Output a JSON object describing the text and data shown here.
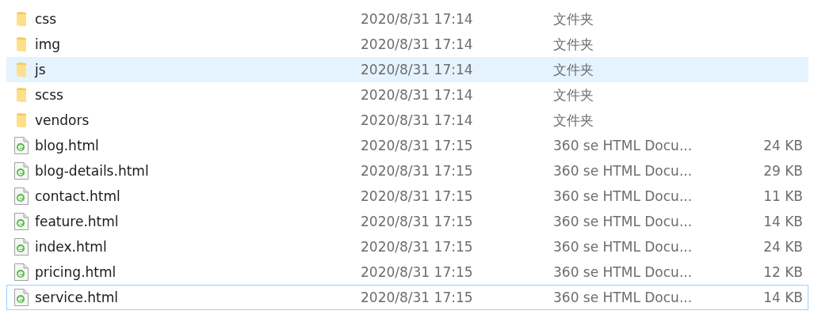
{
  "files": [
    {
      "kind": "folder",
      "name": "css",
      "modified": "2020/8/31 17:14",
      "type": "文件夹",
      "highlighted": false,
      "focused": false
    },
    {
      "kind": "folder",
      "name": "img",
      "modified": "2020/8/31 17:14",
      "type": "文件夹",
      "highlighted": false,
      "focused": false
    },
    {
      "kind": "folder",
      "name": "js",
      "modified": "2020/8/31 17:14",
      "type": "文件夹",
      "highlighted": true,
      "focused": false
    },
    {
      "kind": "folder",
      "name": "scss",
      "modified": "2020/8/31 17:14",
      "type": "文件夹",
      "highlighted": false,
      "focused": false
    },
    {
      "kind": "folder",
      "name": "vendors",
      "modified": "2020/8/31 17:14",
      "type": "文件夹",
      "highlighted": false,
      "focused": false
    },
    {
      "kind": "html",
      "name": "blog.html",
      "modified": "2020/8/31 17:15",
      "type": "360 se HTML Docu...",
      "size": "24 KB",
      "highlighted": false,
      "focused": false
    },
    {
      "kind": "html",
      "name": "blog-details.html",
      "modified": "2020/8/31 17:15",
      "type": "360 se HTML Docu...",
      "size": "29 KB",
      "highlighted": false,
      "focused": false
    },
    {
      "kind": "html",
      "name": "contact.html",
      "modified": "2020/8/31 17:15",
      "type": "360 se HTML Docu...",
      "size": "11 KB",
      "highlighted": false,
      "focused": false
    },
    {
      "kind": "html",
      "name": "feature.html",
      "modified": "2020/8/31 17:15",
      "type": "360 se HTML Docu...",
      "size": "14 KB",
      "highlighted": false,
      "focused": false
    },
    {
      "kind": "html",
      "name": "index.html",
      "modified": "2020/8/31 17:15",
      "type": "360 se HTML Docu...",
      "size": "24 KB",
      "highlighted": false,
      "focused": false
    },
    {
      "kind": "html",
      "name": "pricing.html",
      "modified": "2020/8/31 17:15",
      "type": "360 se HTML Docu...",
      "size": "12 KB",
      "highlighted": false,
      "focused": false
    },
    {
      "kind": "html",
      "name": "service.html",
      "modified": "2020/8/31 17:15",
      "type": "360 se HTML Docu...",
      "size": "14 KB",
      "highlighted": false,
      "focused": true
    }
  ]
}
